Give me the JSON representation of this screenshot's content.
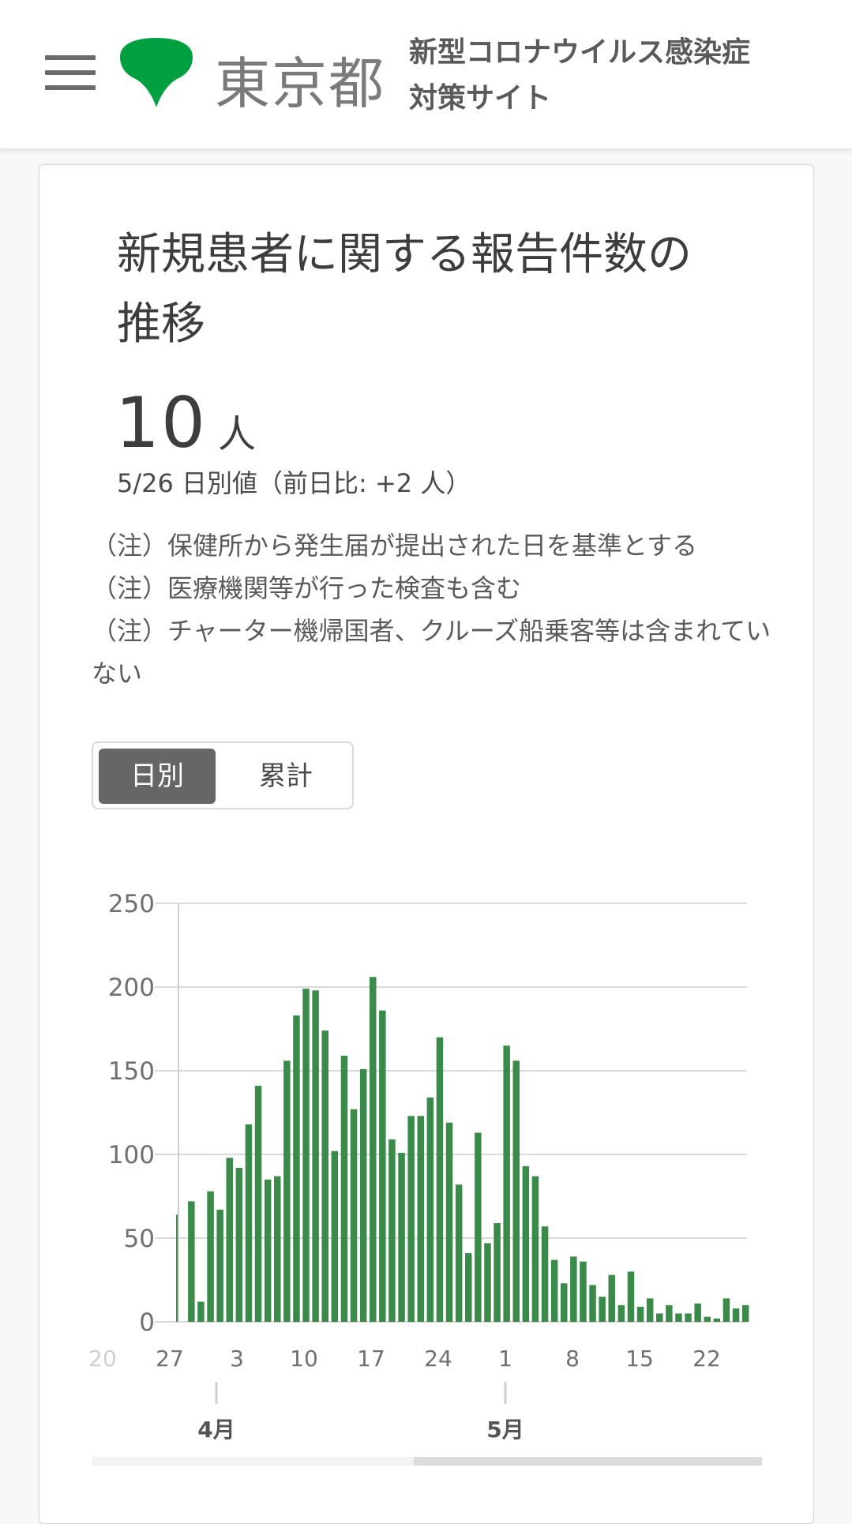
{
  "header": {
    "logo_text": "東京都",
    "site_title_line1": "新型コロナウイルス感染症",
    "site_title_line2": "対策サイト",
    "brand_color": "#00a040",
    "menu_icon": "hamburger-icon",
    "logo_icon": "ginkgo-leaf-icon"
  },
  "card": {
    "title": "新規患者に関する報告件数の推移",
    "value": "10",
    "unit": "人",
    "sub_value": "5/26 日別値（前日比: +2 人）",
    "notes": [
      "（注）保健所から発生届が提出された日を基準とする",
      "（注）医療機関等が行った検査も含む",
      "（注）チャーター機帰国者、クルーズ船乗客等は含まれていない"
    ],
    "toggle": {
      "daily": "日別",
      "cumulative": "累計",
      "selected": "日別"
    }
  },
  "chart_data": {
    "type": "bar",
    "bar_color": "#3a8a4a",
    "ylim": [
      0,
      250
    ],
    "y_ticks": [
      "0",
      "50",
      "100",
      "150",
      "200",
      "250"
    ],
    "x_tick_labels": [
      "20",
      "27",
      "3",
      "10",
      "17",
      "24",
      "1",
      "8",
      "15",
      "22"
    ],
    "month_labels": [
      "4月",
      "5月"
    ],
    "values": [
      64,
      72,
      12,
      78,
      67,
      98,
      92,
      118,
      141,
      85,
      87,
      156,
      183,
      199,
      198,
      174,
      102,
      159,
      127,
      151,
      206,
      186,
      109,
      101,
      123,
      123,
      134,
      170,
      119,
      82,
      41,
      113,
      47,
      59,
      165,
      156,
      93,
      87,
      57,
      37,
      23,
      39,
      36,
      22,
      15,
      28,
      10,
      30,
      9,
      14,
      5,
      10,
      5,
      5,
      11,
      3,
      2,
      14,
      8,
      10
    ]
  }
}
